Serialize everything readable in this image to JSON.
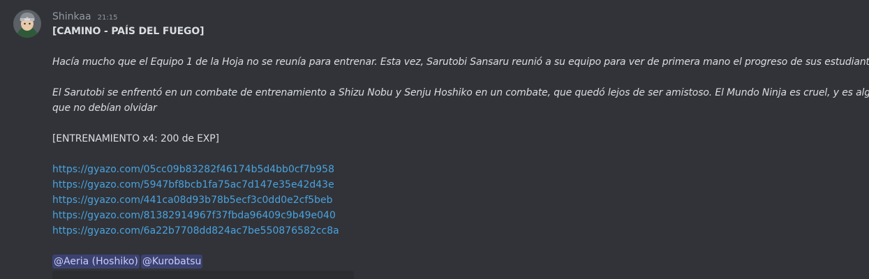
{
  "message": {
    "author": "Shinkaa",
    "timestamp": "21:15",
    "title": "[CAMINO - PAÍS DEL FUEGO]",
    "paragraph1": "Hacía mucho que el Equipo 1 de la Hoja no se reunía para entrenar. Esta vez, Sarutobi Sansaru reunió a su equipo para ver de primera mano el progreso de sus estudiantes.",
    "paragraph2_line1": "El Sarutobi se enfrentó en un combate de entrenamiento a Shizu Nobu y Senju Hoshiko en un combate, que quedó lejos de ser amistoso. El Mundo Ninja es cruel, y es algo",
    "paragraph2_line2": "que no debían olvidar",
    "reward": "[ENTRENAMIENTO x4: 200 de EXP]",
    "links": [
      "https://gyazo.com/05cc09b83282f46174b5d4bb0cf7b958",
      "https://gyazo.com/5947bf8bcb1fa75ac7d147e35e42d43e",
      "https://gyazo.com/441ca08d93b78b5ecf3c0dd0e2cf5beb",
      "https://gyazo.com/81382914967f37fbda96409c9b49e040",
      "https://gyazo.com/6a22b7708dd824ac7be550876582cc8a"
    ],
    "mentions": [
      "@Aeria (Hoshiko)",
      "@Kurobatsu"
    ]
  },
  "colors": {
    "background": "#313338",
    "text": "#dbdee1",
    "muted": "#949ba4",
    "link": "#4aa3e0",
    "mention_bg": "#3c4270",
    "mention_text": "#c9cdfb"
  }
}
